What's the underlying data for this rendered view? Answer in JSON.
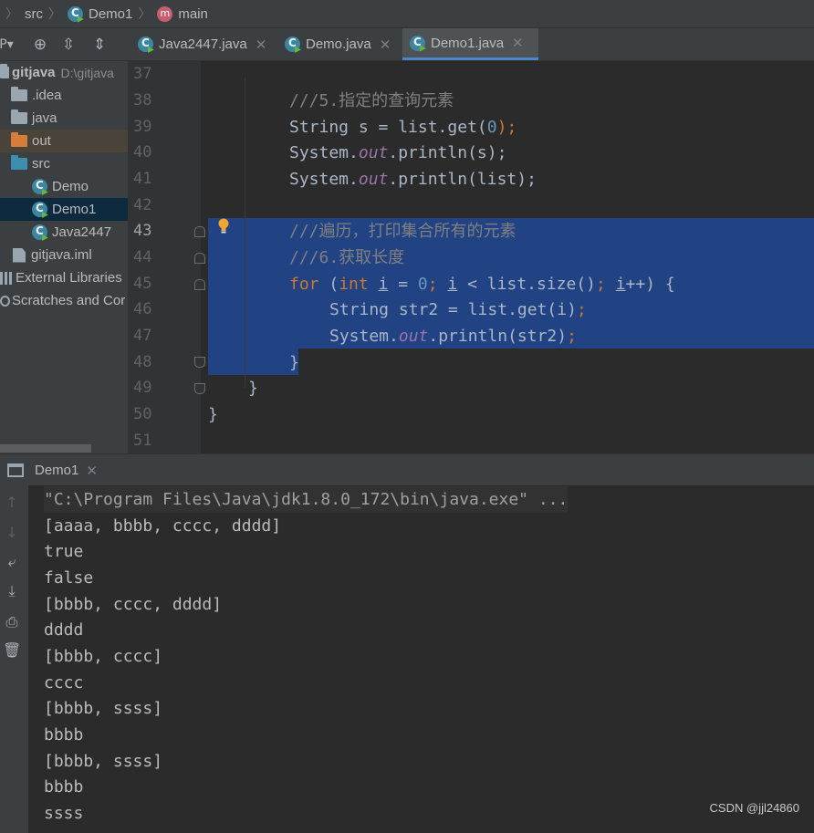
{
  "breadcrumb": {
    "items": [
      "src",
      "Demo1",
      "main"
    ],
    "method_badge": "m"
  },
  "toolbar": {
    "project_dropdown": "P",
    "icons": [
      "project-dropdown-icon",
      "locate-icon",
      "expand-all-icon",
      "collapse-all-icon"
    ]
  },
  "tabs": [
    {
      "label": "Java2447.java",
      "active": false
    },
    {
      "label": "Demo.java",
      "active": false
    },
    {
      "label": "Demo1.java",
      "active": true
    }
  ],
  "project": {
    "root_name": "gitjava",
    "root_path": "D:\\gitjava",
    "items": [
      {
        "label": ".idea",
        "type": "folder"
      },
      {
        "label": "java",
        "type": "folder"
      },
      {
        "label": "out",
        "type": "folder-excluded"
      },
      {
        "label": "src",
        "type": "folder-source"
      },
      {
        "label": "Demo",
        "type": "class"
      },
      {
        "label": "Demo1",
        "type": "class",
        "selected": true
      },
      {
        "label": "Java2447",
        "type": "class"
      },
      {
        "label": "gitjava.iml",
        "type": "iml"
      },
      {
        "label": "External Libraries",
        "type": "libraries"
      },
      {
        "label": "Scratches and Cor",
        "type": "scratches"
      }
    ]
  },
  "editor": {
    "line_numbers": [
      "37",
      "38",
      "39",
      "40",
      "41",
      "42",
      "43",
      "44",
      "45",
      "46",
      "47",
      "48",
      "49",
      "50",
      "51"
    ],
    "current_line": "43",
    "lines": {
      "l38": "///5.指定的查询元素",
      "l39_a": "String s = list.get(",
      "l39_num": "0",
      "l39_b": ");",
      "l40_a": "System.",
      "l40_fld": "out",
      "l40_b": ".println(s);",
      "l41_a": "System.",
      "l41_fld": "out",
      "l41_b": ".println(list);",
      "l43": "///遍历，打印集合所有的元素",
      "l44": "///6.获取长度",
      "l45_for": "for",
      "l45_p1": " (",
      "l45_int": "int",
      "l45_sp": " ",
      "l45_i1": "i",
      "l45_eq": " = ",
      "l45_zero": "0",
      "l45_semi1": ";",
      "l45_sp2": " ",
      "l45_i2": "i",
      "l45_mid": " < list.size()",
      "l45_semi2": ";",
      "l45_sp3": " ",
      "l45_i3": "i",
      "l45_end": "++) {",
      "l46_a": "String str2 = list.get(i)",
      "l46_b": ";",
      "l47_a": "System.",
      "l47_fld": "out",
      "l47_b": ".println(str2)",
      "l47_c": ";",
      "l48": "}",
      "l49": "}",
      "l50": "}"
    }
  },
  "run": {
    "tab_label": "Demo1",
    "output": [
      "\"C:\\Program Files\\Java\\jdk1.8.0_172\\bin\\java.exe\" ...",
      "[aaaa, bbbb, cccc, dddd]",
      "true",
      "false",
      "[bbbb, cccc, dddd]",
      "dddd",
      "[bbbb, cccc]",
      "cccc",
      "[bbbb, ssss]",
      "bbbb",
      "[bbbb, ssss]",
      "bbbb",
      "ssss"
    ]
  },
  "watermark": "CSDN @jjl24860",
  "colors": {
    "selection": "#214283",
    "keyword": "#cc7832",
    "number": "#6897bb",
    "field": "#9876aa",
    "comment": "#808080"
  }
}
